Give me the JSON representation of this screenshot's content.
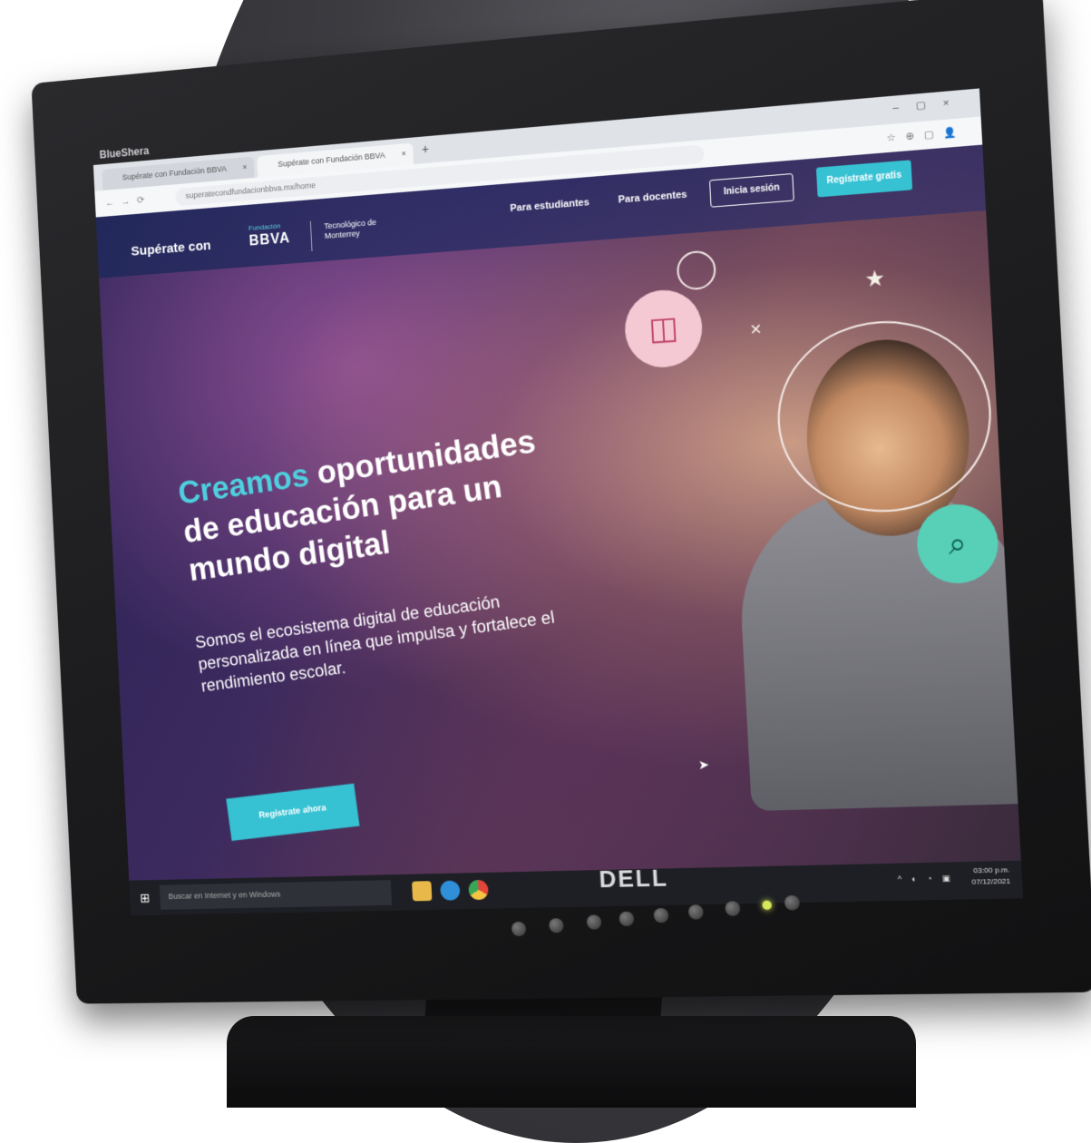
{
  "monitor": {
    "brand_label": "BlueShera",
    "logo": "DELL"
  },
  "browser": {
    "tabs": [
      {
        "label": "Supérate con Fundación BBVA"
      },
      {
        "label": "Supérate con Fundación BBVA"
      }
    ],
    "url": "superatecondfundacionbbva.mx/home"
  },
  "site": {
    "logo_text": "Supérate con",
    "logo_fundacion": "Fundación",
    "logo_bbva": "BBVA",
    "logo_tec": "Tecnológico de Monterrey",
    "nav": {
      "students": "Para estudiantes",
      "teachers": "Para docentes",
      "login": "Inicia sesión",
      "register": "Regístrate gratis"
    },
    "hero": {
      "title_accent": "Creamos",
      "title_rest": "oportunidades de educación para un mundo digital",
      "subtitle": "Somos el ecosistema digital de educación personalizada en línea que impulsa y fortalece el rendimiento escolar.",
      "cta": "Regístrate ahora"
    }
  },
  "taskbar": {
    "search_placeholder": "Buscar en Internet y en Windows",
    "time": "03:00 p.m.",
    "date": "07/12/2021"
  },
  "colors": {
    "accent": "#36c2d3",
    "bezel": "#1b1b1d"
  }
}
